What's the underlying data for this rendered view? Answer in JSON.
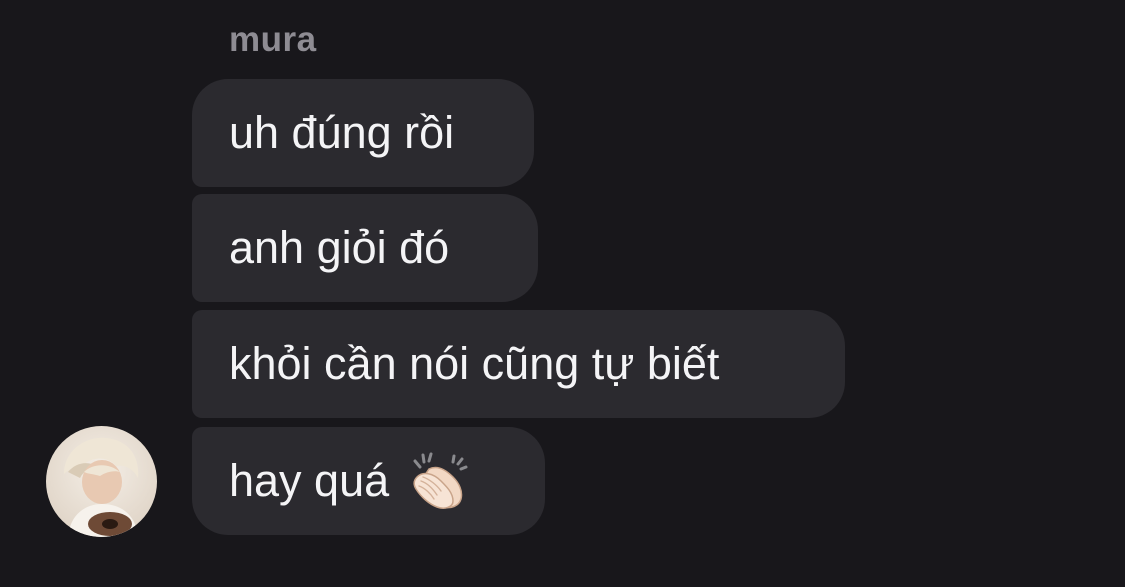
{
  "sender": {
    "name": "mura"
  },
  "messages": [
    {
      "text": "uh đúng rồi"
    },
    {
      "text": "anh giỏi đó"
    },
    {
      "text": "khỏi cần nói cũng tự biết"
    },
    {
      "text": "hay quá",
      "emoji": "clapping-hands-emoji"
    }
  ],
  "colors": {
    "background": "#18171b",
    "bubble": "#2b2a2f",
    "text": "#f4f4f6",
    "sender_name": "#8e8c93"
  }
}
